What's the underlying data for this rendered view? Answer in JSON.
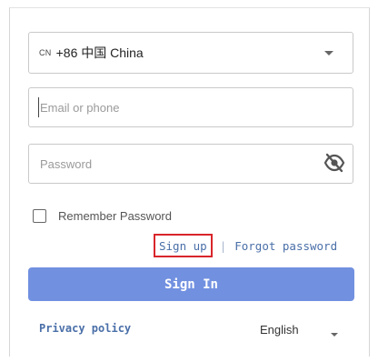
{
  "country": {
    "code": "CN",
    "label": "+86 中国 China",
    "icon": "chevron-down-icon"
  },
  "email": {
    "placeholder": "Email or phone",
    "value": ""
  },
  "password": {
    "placeholder": "Password",
    "value": "",
    "toggle_icon": "eye-off-icon"
  },
  "remember": {
    "label": "Remember Password",
    "checked": false
  },
  "links": {
    "signup": "Sign up",
    "separator": "|",
    "forgot": "Forgot password"
  },
  "signin": {
    "label": "Sign In"
  },
  "footer": {
    "privacy": "Privacy policy",
    "language": "English",
    "language_icon": "chevron-down-icon"
  },
  "colors": {
    "primary_button": "#7190e0",
    "link": "#4a6fa8",
    "highlight_box": "#d9252b"
  }
}
